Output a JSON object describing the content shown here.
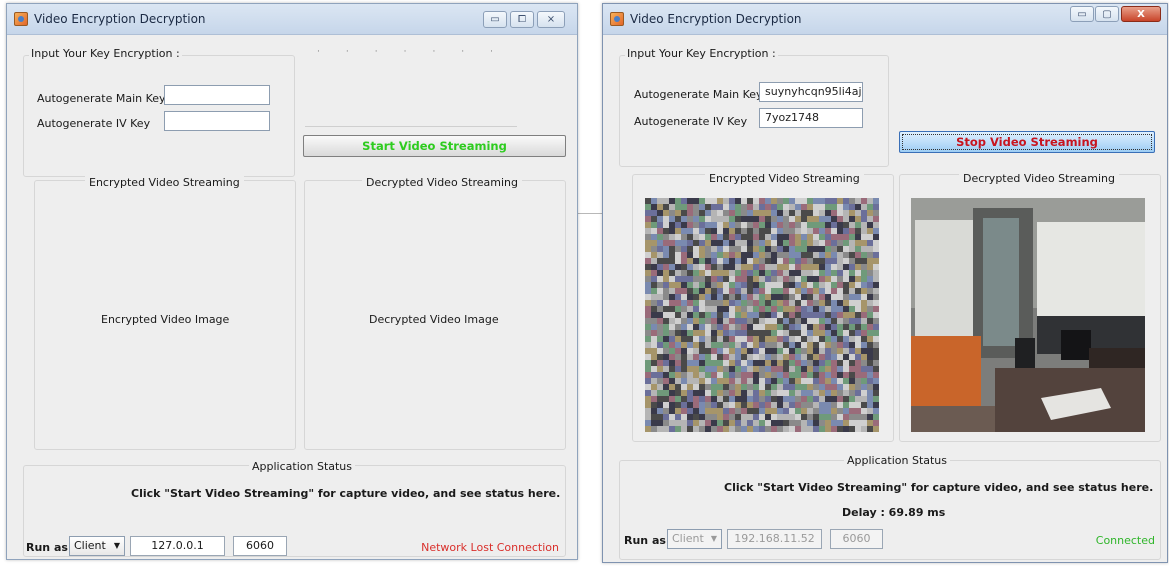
{
  "left_window": {
    "title": "Video Encryption Decryption",
    "controls": [
      "▭",
      "⧠",
      "⨯"
    ],
    "key_group_title": "Input Your Key Encryption :",
    "main_key_label": "Autogenerate Main Key :",
    "iv_key_label": "Autogenerate IV Key    :",
    "main_key_value": "",
    "iv_key_value": "",
    "stream_button": "Start Video Streaming",
    "encrypted_panel_title": "Encrypted Video Streaming",
    "decrypted_panel_title": "Decrypted Video Streaming",
    "encrypted_placeholder": "Encrypted Video Image",
    "decrypted_placeholder": "Decrypted Video Image",
    "status_title": "Application Status",
    "status_message": "Click \"Start Video Streaming\" for capture video, and see status here.",
    "run_as_label": "Run as :",
    "run_as_value": "Client",
    "ip": "127.0.0.1",
    "port": "6060",
    "connection_status": "Network Lost Connection"
  },
  "right_window": {
    "title": "Video Encryption Decryption",
    "controls": [
      "▭",
      "▢",
      "X"
    ],
    "key_group_title": "Input Your Key Encryption :",
    "main_key_label": "Autogenerate Main Key :",
    "iv_key_label": "Autogenerate IV Key    :",
    "main_key_value": "suynyhcqn95li4aj",
    "iv_key_value": "7yoz1748",
    "stream_button": "Stop Video Streaming",
    "encrypted_panel_title": "Encrypted Video Streaming",
    "decrypted_panel_title": "Decrypted Video Streaming",
    "status_title": "Application Status",
    "status_message": "Click \"Start Video Streaming\" for capture video, and see status here.",
    "delay": "Delay : 69.89 ms",
    "run_as_label": "Run as :",
    "run_as_value": "Client",
    "ip": "192.168.11.52",
    "port": "6060",
    "connection_status": "Connected"
  },
  "colors": {
    "start_button_text": "#2ecc1f",
    "stop_button_text": "#c8141e",
    "lost_connection": "#d9302c",
    "connected": "#2fb52a"
  }
}
